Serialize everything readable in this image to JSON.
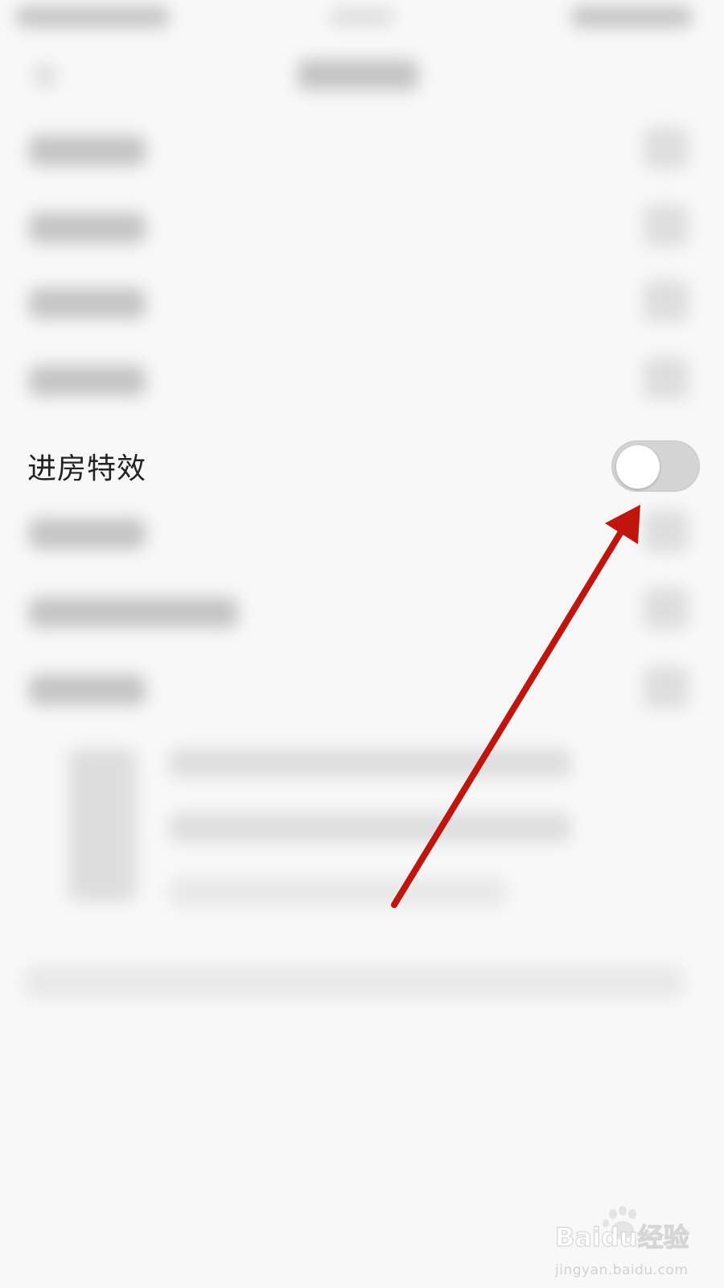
{
  "settings": {
    "entry_effect": {
      "label": "进房特效",
      "enabled": false
    }
  },
  "watermark": {
    "brand": "Baidu经验",
    "url": "jingyan.baidu.com"
  },
  "colors": {
    "background": "#f8f8f8",
    "toggle_off": "#d4d4d4",
    "annotation_arrow": "#c0140c"
  },
  "icons": {
    "annotation": "red-arrow-icon",
    "watermark": "baidu-paw-icon"
  }
}
